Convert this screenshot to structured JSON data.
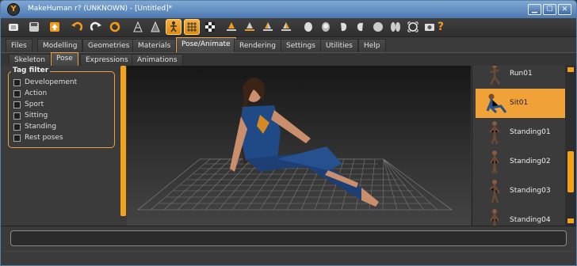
{
  "titlebar": {
    "app_icon": "makehuman-logo-icon",
    "title": "MakeHuman r? (UNKNOWN) - [Untitled]*",
    "minimize": "▁",
    "maximize": "☐",
    "close": "✕"
  },
  "toolbar": {
    "help_label": "?",
    "items": [
      "new-icon",
      "save-icon",
      "export-icon",
      "undo-icon",
      "redo-icon",
      "reset-icon",
      "wireframe-icon",
      "smooth-icon",
      "pose-icon",
      "grid-icon",
      "checker-icon",
      "front-view-icon",
      "back-view-icon",
      "left-view-icon",
      "right-view-icon",
      "top-view-icon",
      "bottom-view-icon",
      "reset-camera-icon",
      "screenshot-icon",
      "help-icon"
    ]
  },
  "main_tabs": [
    {
      "label": "Files"
    },
    {
      "label": "Modelling"
    },
    {
      "label": "Geometries"
    },
    {
      "label": "Materials"
    },
    {
      "label": "Pose/Animate",
      "active": true
    },
    {
      "label": "Rendering"
    },
    {
      "label": "Settings"
    },
    {
      "label": "Utilities"
    },
    {
      "label": "Help"
    }
  ],
  "sub_tabs": [
    {
      "label": "Skeleton"
    },
    {
      "label": "Pose",
      "active": true
    },
    {
      "label": "Expressions"
    },
    {
      "label": "Animations"
    }
  ],
  "tag_filter": {
    "title": "Tag filter",
    "items": [
      "Developement",
      "Action",
      "Sport",
      "Sitting",
      "Standing",
      "Rest poses"
    ]
  },
  "poses": [
    {
      "label": "Run01",
      "selected": false
    },
    {
      "label": "Sit01",
      "selected": true
    },
    {
      "label": "Standing01",
      "selected": false
    },
    {
      "label": "Standing02",
      "selected": false
    },
    {
      "label": "Standing03",
      "selected": false
    },
    {
      "label": "Standing04",
      "selected": false
    }
  ],
  "colors": {
    "accent": "#f0a238",
    "titlebar": "#5b86bd",
    "background": "#3b3b3b"
  }
}
